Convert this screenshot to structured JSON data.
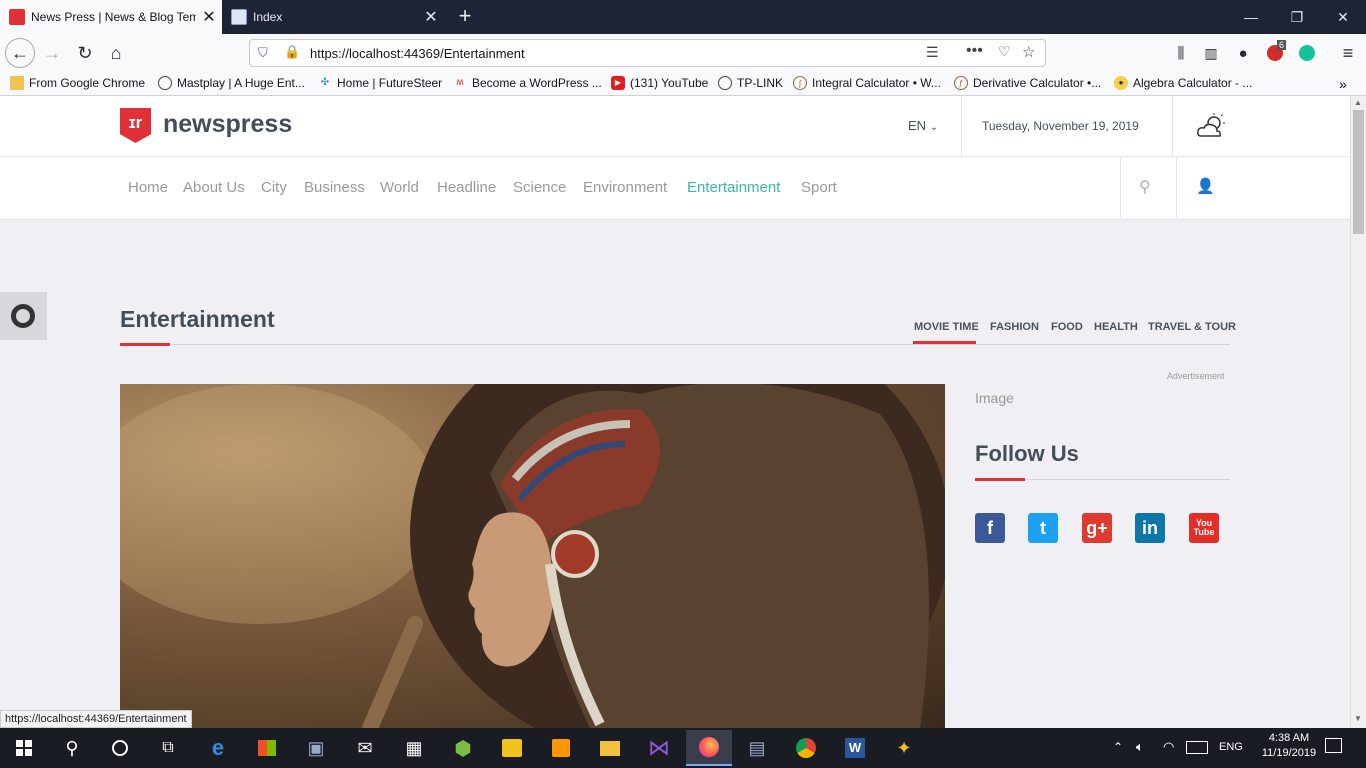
{
  "browser": {
    "tabs": [
      {
        "title": "News Press | News & Blog Template",
        "active": true
      },
      {
        "title": "Index",
        "active": false
      }
    ],
    "url": "https://localhost:44369/Entertainment",
    "url_host": "localhost",
    "extension_badge": "6",
    "bookmarks": [
      "From Google Chrome",
      "Mastplay | A Huge Ent...",
      "Home | FutureSteer",
      "Become a WordPress ...",
      "(131) YouTube",
      "TP-LINK",
      "Integral Calculator • W...",
      "Derivative Calculator •...",
      "Algebra Calculator - ..."
    ],
    "status_url": "https://localhost:44369/Entertainment"
  },
  "site": {
    "logo_text": "newspress",
    "language": "EN",
    "date": "Tuesday, November 19, 2019",
    "menu": [
      "Home",
      "About Us",
      "City",
      "Business",
      "World",
      "Headline",
      "Science",
      "Environment",
      "Entertainment",
      "Sport"
    ],
    "active_menu": "Entertainment",
    "section_title": "Entertainment",
    "subtabs": [
      "MOVIE TIME",
      "FASHION",
      "FOOD",
      "HEALTH",
      "TRAVEL & TOUR"
    ],
    "active_subtab": "MOVIE TIME",
    "ad_label": "Advertisement",
    "ad_image_alt": "Image",
    "follow_title": "Follow Us",
    "socials": [
      {
        "name": "facebook",
        "glyph": "f",
        "color": "#3b5998"
      },
      {
        "name": "twitter",
        "glyph": "t",
        "color": "#1da1f2"
      },
      {
        "name": "google-plus",
        "glyph": "g+",
        "color": "#dd3b2f"
      },
      {
        "name": "linkedin",
        "glyph": "in",
        "color": "#0e76a8"
      },
      {
        "name": "youtube",
        "glyph": "You Tube",
        "color": "#e52d27"
      }
    ],
    "colors": {
      "accent": "#3bb5ad",
      "brand_red": "#e03236",
      "text": "#444d5a"
    }
  },
  "taskbar": {
    "time": "4:38 AM",
    "date": "11/19/2019",
    "lang": "ENG"
  }
}
